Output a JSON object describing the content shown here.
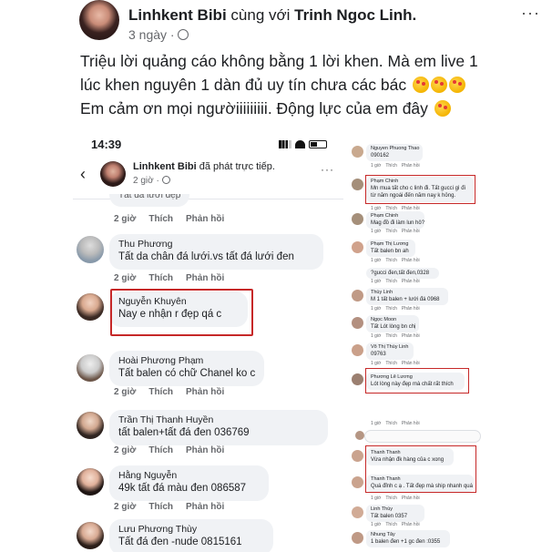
{
  "post": {
    "author": "Linhkent Bibi",
    "with_text": "cùng với",
    "tagged": "Trinh Ngoc Linh.",
    "time": "3 ngày ·",
    "more": "···",
    "caption": [
      "Triệu lời quảng cáo không bằng 1 lời khen. Mà em live 1",
      "lúc khen nguyên 1 dàn đủ uy tín chưa các bác",
      "Em cảm ơn mọi ngườiiiiiiiii. Động lực của em đây"
    ]
  },
  "left_shot": {
    "status_time": "14:39",
    "live_author": "Linhkent Bibi",
    "live_action": "đã phát trực tiếp.",
    "live_time": "2 giờ ·",
    "more": "···",
    "top_partial": "Tất đá lưới đẹp",
    "actions": {
      "time": "2 giờ",
      "like": "Thích",
      "reply": "Phản hồi"
    },
    "comments": [
      {
        "name": "Thu Phương",
        "text": "Tất da chân đá lưới.vs tất đá lưới đen"
      },
      {
        "name": "Nguyễn Khuyên",
        "text": "Nay e nhận r đẹp qá c"
      },
      {
        "name": "Hoài Phương Phạm",
        "text": "Tất balen có chữ Chanel ko c"
      },
      {
        "name": "Trần Thị Thanh Huyền",
        "text": "tất balen+tất đá đen 036769"
      },
      {
        "name": "Hằng Nguyễn",
        "text": "49k tất đá màu đen 086587"
      },
      {
        "name": "Lưu Phương Thùy",
        "text": "Tất đá đen -nude 0815161"
      }
    ]
  },
  "right_shot": {
    "actions": {
      "time": "1 giờ",
      "like": "Thích",
      "reply": "Phản hồi"
    },
    "comments": [
      {
        "name": "Nguyen Phuong Thao",
        "text": "090162"
      },
      {
        "name": "Phạm Chinh",
        "text": "Mn mua tất cho c linh đi. Tất gucci gì đi từ năm ngoái đến năm nay k hỏng."
      },
      {
        "name": "Phạm Chinh",
        "text": "Mag đồ đi làm lun hô?"
      },
      {
        "name": "Phạm Thị Lương",
        "text": "Tất balen bn ah"
      },
      {
        "name": "",
        "text": "?gucci đen,tất đen,0328"
      },
      {
        "name": "Thùy Linh",
        "text": "M 1 tất balen + lưới đá 0968"
      },
      {
        "name": "Ngọc Moon",
        "text": "Tất Lót lòng bn chị"
      },
      {
        "name": "Võ Thị Thùy Linh",
        "text": "09763"
      },
      {
        "name": "Phương Lê Lương",
        "text": "Lót lòng này đẹp mà chất rất thích"
      },
      {
        "name": "Thanh Thanh",
        "text": "Vừa nhận đk hàng của c xong"
      },
      {
        "name": "Thanh Thanh",
        "text": "Quá đỉnh c ạ . Tất đẹp mà ship nhanh quá"
      },
      {
        "name": "Linh Thùy",
        "text": "Tất balen 0357"
      },
      {
        "name": "Nhung Tây",
        "text": "1 balen đen +1 gc đen :0355"
      }
    ]
  }
}
